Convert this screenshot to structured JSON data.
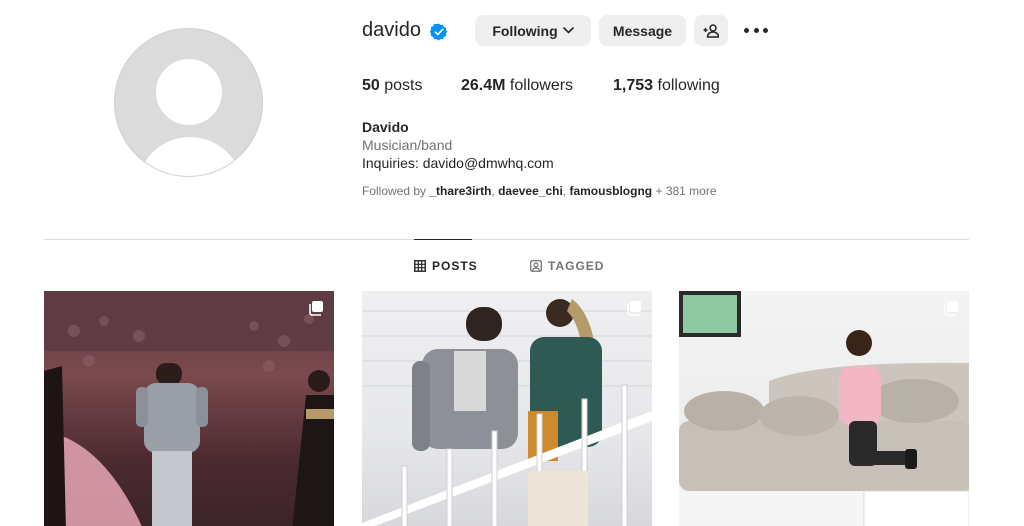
{
  "profile": {
    "username": "davido",
    "full_name": "Davido",
    "category": "Musician/band",
    "bio": "Inquiries: davido@dmwhq.com",
    "verified_color": "#0095f6"
  },
  "actions": {
    "following_label": "Following",
    "message_label": "Message"
  },
  "stats": {
    "posts_count": "50",
    "posts_label": "posts",
    "followers_count": "26.4M",
    "followers_label": "followers",
    "following_count": "1,753",
    "following_label": "following"
  },
  "followed_by": {
    "prefix": "Followed by ",
    "names": [
      "_thare3irth",
      "daevee_chi",
      "famousblogng"
    ],
    "suffix": " + 381 more"
  },
  "tabs": {
    "posts": "POSTS",
    "tagged": "TAGGED"
  },
  "posts": [
    {
      "icon": "multiple-images-icon"
    },
    {
      "icon": "multiple-images-icon"
    },
    {
      "icon": "multiple-images-icon"
    }
  ]
}
